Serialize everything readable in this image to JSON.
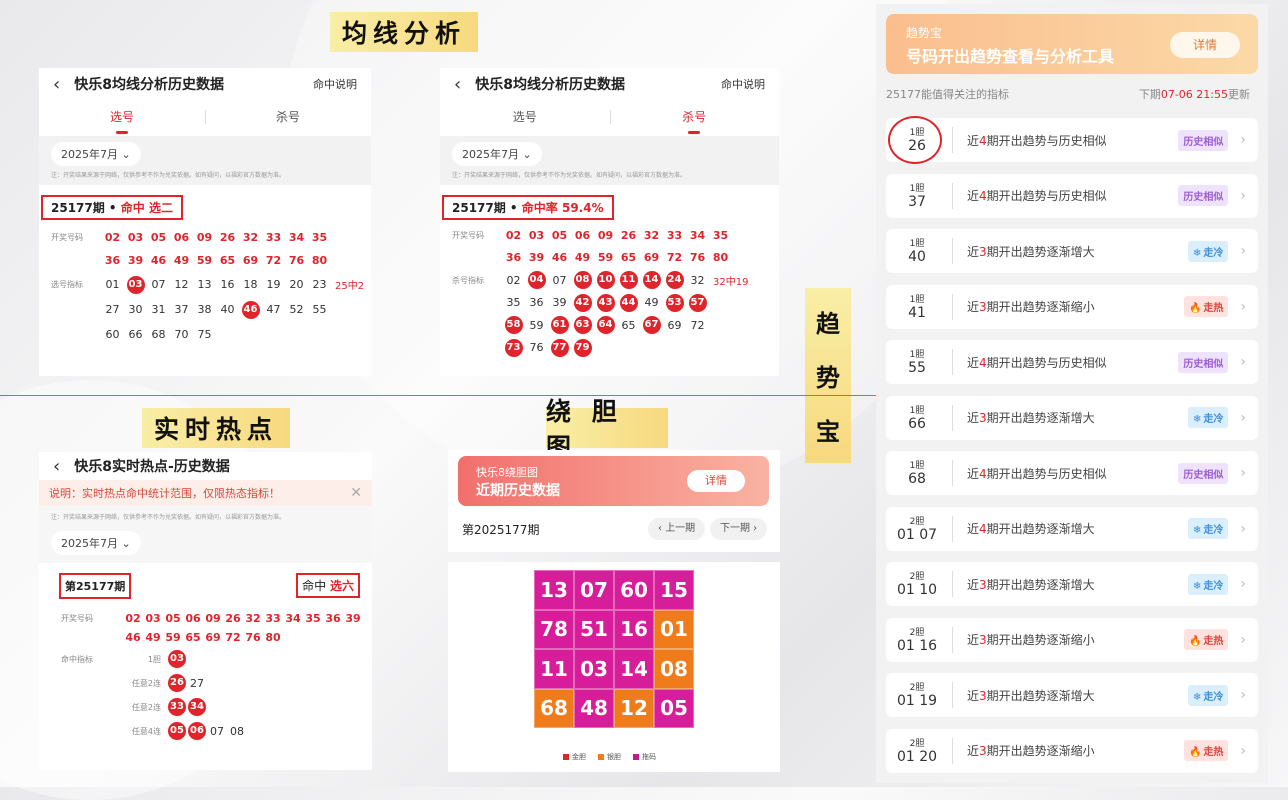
{
  "headers": {
    "ma": "均线分析",
    "hot": "实时热点",
    "gall": "绕 胆 图",
    "trend": [
      "趋",
      "势",
      "宝"
    ]
  },
  "colors": {
    "red": "#e0242b",
    "header_bg": "#f7d97f",
    "purple": "#c7178f",
    "orange": "#f07b1a",
    "magenta": "#d81d9a"
  },
  "ma1": {
    "title": "快乐8均线分析历史数据",
    "help": "命中说明",
    "tabs": [
      "选号",
      "杀号"
    ],
    "month": "2025年7月",
    "note": "注：开奖结果来源于网络，仅供参考不作为兑奖依据。如有疑问，以福彩官方数据为准。",
    "period": "25177期",
    "hit_prefix": "命中",
    "hit": "选二",
    "draw_label": "开奖号码",
    "draw": [
      "02",
      "03",
      "05",
      "06",
      "09",
      "26",
      "32",
      "33",
      "34",
      "35",
      "36",
      "39",
      "46",
      "49",
      "59",
      "65",
      "69",
      "72",
      "76",
      "80"
    ],
    "pick_label": "选号指标",
    "pick": [
      {
        "v": "01",
        "h": false
      },
      {
        "v": "03",
        "h": true
      },
      {
        "v": "07",
        "h": false
      },
      {
        "v": "12",
        "h": false
      },
      {
        "v": "13",
        "h": false
      },
      {
        "v": "16",
        "h": false
      },
      {
        "v": "18",
        "h": false
      },
      {
        "v": "19",
        "h": false
      },
      {
        "v": "20",
        "h": false
      },
      {
        "v": "23",
        "h": false
      },
      {
        "v": "27",
        "h": false
      },
      {
        "v": "30",
        "h": false
      },
      {
        "v": "31",
        "h": false
      },
      {
        "v": "37",
        "h": false
      },
      {
        "v": "38",
        "h": false
      },
      {
        "v": "40",
        "h": false
      },
      {
        "v": "46",
        "h": true
      },
      {
        "v": "47",
        "h": false
      },
      {
        "v": "52",
        "h": false
      },
      {
        "v": "55",
        "h": false
      },
      {
        "v": "60",
        "h": false
      },
      {
        "v": "66",
        "h": false
      },
      {
        "v": "68",
        "h": false
      },
      {
        "v": "70",
        "h": false
      },
      {
        "v": "75",
        "h": false
      }
    ],
    "pick_tail": "25中2"
  },
  "ma2": {
    "title": "快乐8均线分析历史数据",
    "help": "命中说明",
    "tabs": [
      "选号",
      "杀号"
    ],
    "month": "2025年7月",
    "note": "注：开奖结果来源于网络，仅供参考不作为兑奖依据。如有疑问，以福彩官方数据为准。",
    "period": "25177期",
    "hit_prefix": "命中率",
    "hit": "59.4%",
    "draw_label": "开奖号码",
    "draw": [
      "02",
      "03",
      "05",
      "06",
      "09",
      "26",
      "32",
      "33",
      "34",
      "35",
      "36",
      "39",
      "46",
      "49",
      "59",
      "65",
      "69",
      "72",
      "76",
      "80"
    ],
    "kill_label": "杀号指标",
    "kill": [
      {
        "v": "02",
        "h": false
      },
      {
        "v": "04",
        "h": true
      },
      {
        "v": "07",
        "h": false
      },
      {
        "v": "08",
        "h": true
      },
      {
        "v": "10",
        "h": true
      },
      {
        "v": "11",
        "h": true
      },
      {
        "v": "14",
        "h": true
      },
      {
        "v": "24",
        "h": true
      },
      {
        "v": "32",
        "h": false
      },
      {
        "v": "35",
        "h": false
      },
      {
        "v": "36",
        "h": false
      },
      {
        "v": "39",
        "h": false
      },
      {
        "v": "42",
        "h": true
      },
      {
        "v": "43",
        "h": true
      },
      {
        "v": "44",
        "h": true
      },
      {
        "v": "49",
        "h": false
      },
      {
        "v": "53",
        "h": true
      },
      {
        "v": "57",
        "h": true
      },
      {
        "v": "58",
        "h": true
      },
      {
        "v": "59",
        "h": false
      },
      {
        "v": "61",
        "h": true
      },
      {
        "v": "63",
        "h": true
      },
      {
        "v": "64",
        "h": true
      },
      {
        "v": "65",
        "h": false
      },
      {
        "v": "67",
        "h": true
      },
      {
        "v": "69",
        "h": false
      },
      {
        "v": "72",
        "h": false
      },
      {
        "v": "73",
        "h": true
      },
      {
        "v": "76",
        "h": false
      },
      {
        "v": "77",
        "h": true
      },
      {
        "v": "79",
        "h": true
      }
    ],
    "kill_tail": "32中19"
  },
  "hot": {
    "title": "快乐8实时热点-历史数据",
    "warn": "说明：实时热点命中统计范围，仅限热态指标！",
    "note": "注：开奖结果来源于网络，仅供参考不作为兑奖依据。如有疑问，以福彩官方数据为准。",
    "month": "2025年7月",
    "period": "第25177期",
    "hit_prefix": "命中",
    "hit": "选六",
    "draw_label": "开奖号码",
    "draw": [
      "02",
      "03",
      "05",
      "06",
      "09",
      "26",
      "32",
      "33",
      "34",
      "35",
      "36",
      "39",
      "46",
      "49",
      "59",
      "65",
      "69",
      "72",
      "76",
      "80"
    ],
    "ind_label": "命中指标",
    "rows": [
      {
        "label": "1胆",
        "nums": [
          {
            "v": "03",
            "h": true
          }
        ]
      },
      {
        "label": "任意2连",
        "nums": [
          {
            "v": "26",
            "h": true
          },
          {
            "v": "27",
            "h": false
          }
        ]
      },
      {
        "label": "任意2连",
        "nums": [
          {
            "v": "33",
            "h": true
          },
          {
            "v": "34",
            "h": true
          }
        ]
      },
      {
        "label": "任意4连",
        "nums": [
          {
            "v": "05",
            "h": true
          },
          {
            "v": "06",
            "h": true
          },
          {
            "v": "07",
            "h": false
          },
          {
            "v": "08",
            "h": false
          }
        ]
      }
    ]
  },
  "gall": {
    "banner_sub": "快乐8绕胆图",
    "banner_title": "近期历史数据",
    "btn": "详情",
    "period": "第2025177期",
    "prev": "上一期",
    "next": "下一期",
    "grid": [
      {
        "v": "13",
        "c": "m"
      },
      {
        "v": "07",
        "c": "m"
      },
      {
        "v": "60",
        "c": "m"
      },
      {
        "v": "15",
        "c": "m"
      },
      {
        "v": "78",
        "c": "m"
      },
      {
        "v": "51",
        "c": "m"
      },
      {
        "v": "16",
        "c": "m"
      },
      {
        "v": "01",
        "c": "o"
      },
      {
        "v": "11",
        "c": "m"
      },
      {
        "v": "03",
        "c": "m"
      },
      {
        "v": "14",
        "c": "m"
      },
      {
        "v": "08",
        "c": "o"
      },
      {
        "v": "68",
        "c": "o"
      },
      {
        "v": "48",
        "c": "m"
      },
      {
        "v": "12",
        "c": "o"
      },
      {
        "v": "05",
        "c": "m"
      }
    ],
    "legend": [
      {
        "label": "金胆",
        "color": "#e0242b"
      },
      {
        "label": "银胆",
        "color": "#f07b1a"
      },
      {
        "label": "拖码",
        "color": "#c7178f"
      }
    ]
  },
  "trend": {
    "banner_sub": "趋势宝",
    "banner_title": "号码开出趋势查看与分析工具",
    "btn": "详情",
    "info_left": "25177能值得关注的指标",
    "info_right_pre": "下期",
    "info_right_time": "07-06 21:55",
    "info_right_post": "更新",
    "items": [
      {
        "unit": "1胆",
        "val": "26",
        "pre": "近",
        "n": "4",
        "post": "期开出趋势与历史相似",
        "tag": "历史相似",
        "type": "similar"
      },
      {
        "unit": "1胆",
        "val": "37",
        "pre": "近",
        "n": "4",
        "post": "期开出趋势与历史相似",
        "tag": "历史相似",
        "type": "similar"
      },
      {
        "unit": "1胆",
        "val": "40",
        "pre": "近",
        "n": "3",
        "post": "期开出趋势逐渐增大",
        "tag": "走冷",
        "type": "cold"
      },
      {
        "unit": "1胆",
        "val": "41",
        "pre": "近",
        "n": "3",
        "post": "期开出趋势逐渐缩小",
        "tag": "走热",
        "type": "hot"
      },
      {
        "unit": "1胆",
        "val": "55",
        "pre": "近",
        "n": "4",
        "post": "期开出趋势与历史相似",
        "tag": "历史相似",
        "type": "similar"
      },
      {
        "unit": "1胆",
        "val": "66",
        "pre": "近",
        "n": "3",
        "post": "期开出趋势逐渐增大",
        "tag": "走冷",
        "type": "cold"
      },
      {
        "unit": "1胆",
        "val": "68",
        "pre": "近",
        "n": "4",
        "post": "期开出趋势与历史相似",
        "tag": "历史相似",
        "type": "similar"
      },
      {
        "unit": "2胆",
        "val": "01 07",
        "pre": "近",
        "n": "4",
        "post": "期开出趋势逐渐增大",
        "tag": "走冷",
        "type": "cold"
      },
      {
        "unit": "2胆",
        "val": "01 10",
        "pre": "近",
        "n": "3",
        "post": "期开出趋势逐渐增大",
        "tag": "走冷",
        "type": "cold"
      },
      {
        "unit": "2胆",
        "val": "01 16",
        "pre": "近",
        "n": "3",
        "post": "期开出趋势逐渐缩小",
        "tag": "走热",
        "type": "hot"
      },
      {
        "unit": "2胆",
        "val": "01 19",
        "pre": "近",
        "n": "3",
        "post": "期开出趋势逐渐增大",
        "tag": "走冷",
        "type": "cold"
      },
      {
        "unit": "2胆",
        "val": "01 20",
        "pre": "近",
        "n": "3",
        "post": "期开出趋势逐渐缩小",
        "tag": "走热",
        "type": "hot"
      }
    ]
  }
}
